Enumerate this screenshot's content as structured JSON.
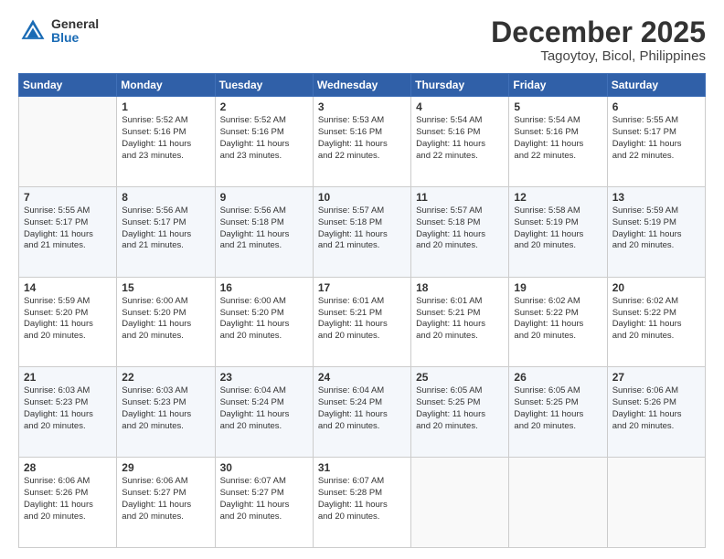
{
  "header": {
    "logo": {
      "general": "General",
      "blue": "Blue"
    },
    "title": "December 2025",
    "subtitle": "Tagoytoy, Bicol, Philippines"
  },
  "weekdays": [
    "Sunday",
    "Monday",
    "Tuesday",
    "Wednesday",
    "Thursday",
    "Friday",
    "Saturday"
  ],
  "weeks": [
    [
      {
        "day": null
      },
      {
        "day": 1,
        "sunrise": "5:52 AM",
        "sunset": "5:16 PM",
        "daylight": "11 hours and 23 minutes."
      },
      {
        "day": 2,
        "sunrise": "5:52 AM",
        "sunset": "5:16 PM",
        "daylight": "11 hours and 23 minutes."
      },
      {
        "day": 3,
        "sunrise": "5:53 AM",
        "sunset": "5:16 PM",
        "daylight": "11 hours and 22 minutes."
      },
      {
        "day": 4,
        "sunrise": "5:54 AM",
        "sunset": "5:16 PM",
        "daylight": "11 hours and 22 minutes."
      },
      {
        "day": 5,
        "sunrise": "5:54 AM",
        "sunset": "5:16 PM",
        "daylight": "11 hours and 22 minutes."
      },
      {
        "day": 6,
        "sunrise": "5:55 AM",
        "sunset": "5:17 PM",
        "daylight": "11 hours and 22 minutes."
      }
    ],
    [
      {
        "day": 7,
        "sunrise": "5:55 AM",
        "sunset": "5:17 PM",
        "daylight": "11 hours and 21 minutes."
      },
      {
        "day": 8,
        "sunrise": "5:56 AM",
        "sunset": "5:17 PM",
        "daylight": "11 hours and 21 minutes."
      },
      {
        "day": 9,
        "sunrise": "5:56 AM",
        "sunset": "5:18 PM",
        "daylight": "11 hours and 21 minutes."
      },
      {
        "day": 10,
        "sunrise": "5:57 AM",
        "sunset": "5:18 PM",
        "daylight": "11 hours and 21 minutes."
      },
      {
        "day": 11,
        "sunrise": "5:57 AM",
        "sunset": "5:18 PM",
        "daylight": "11 hours and 20 minutes."
      },
      {
        "day": 12,
        "sunrise": "5:58 AM",
        "sunset": "5:19 PM",
        "daylight": "11 hours and 20 minutes."
      },
      {
        "day": 13,
        "sunrise": "5:59 AM",
        "sunset": "5:19 PM",
        "daylight": "11 hours and 20 minutes."
      }
    ],
    [
      {
        "day": 14,
        "sunrise": "5:59 AM",
        "sunset": "5:20 PM",
        "daylight": "11 hours and 20 minutes."
      },
      {
        "day": 15,
        "sunrise": "6:00 AM",
        "sunset": "5:20 PM",
        "daylight": "11 hours and 20 minutes."
      },
      {
        "day": 16,
        "sunrise": "6:00 AM",
        "sunset": "5:20 PM",
        "daylight": "11 hours and 20 minutes."
      },
      {
        "day": 17,
        "sunrise": "6:01 AM",
        "sunset": "5:21 PM",
        "daylight": "11 hours and 20 minutes."
      },
      {
        "day": 18,
        "sunrise": "6:01 AM",
        "sunset": "5:21 PM",
        "daylight": "11 hours and 20 minutes."
      },
      {
        "day": 19,
        "sunrise": "6:02 AM",
        "sunset": "5:22 PM",
        "daylight": "11 hours and 20 minutes."
      },
      {
        "day": 20,
        "sunrise": "6:02 AM",
        "sunset": "5:22 PM",
        "daylight": "11 hours and 20 minutes."
      }
    ],
    [
      {
        "day": 21,
        "sunrise": "6:03 AM",
        "sunset": "5:23 PM",
        "daylight": "11 hours and 20 minutes."
      },
      {
        "day": 22,
        "sunrise": "6:03 AM",
        "sunset": "5:23 PM",
        "daylight": "11 hours and 20 minutes."
      },
      {
        "day": 23,
        "sunrise": "6:04 AM",
        "sunset": "5:24 PM",
        "daylight": "11 hours and 20 minutes."
      },
      {
        "day": 24,
        "sunrise": "6:04 AM",
        "sunset": "5:24 PM",
        "daylight": "11 hours and 20 minutes."
      },
      {
        "day": 25,
        "sunrise": "6:05 AM",
        "sunset": "5:25 PM",
        "daylight": "11 hours and 20 minutes."
      },
      {
        "day": 26,
        "sunrise": "6:05 AM",
        "sunset": "5:25 PM",
        "daylight": "11 hours and 20 minutes."
      },
      {
        "day": 27,
        "sunrise": "6:06 AM",
        "sunset": "5:26 PM",
        "daylight": "11 hours and 20 minutes."
      }
    ],
    [
      {
        "day": 28,
        "sunrise": "6:06 AM",
        "sunset": "5:26 PM",
        "daylight": "11 hours and 20 minutes."
      },
      {
        "day": 29,
        "sunrise": "6:06 AM",
        "sunset": "5:27 PM",
        "daylight": "11 hours and 20 minutes."
      },
      {
        "day": 30,
        "sunrise": "6:07 AM",
        "sunset": "5:27 PM",
        "daylight": "11 hours and 20 minutes."
      },
      {
        "day": 31,
        "sunrise": "6:07 AM",
        "sunset": "5:28 PM",
        "daylight": "11 hours and 20 minutes."
      },
      {
        "day": null
      },
      {
        "day": null
      },
      {
        "day": null
      }
    ]
  ],
  "labels": {
    "sunrise": "Sunrise:",
    "sunset": "Sunset:",
    "daylight": "Daylight:"
  }
}
